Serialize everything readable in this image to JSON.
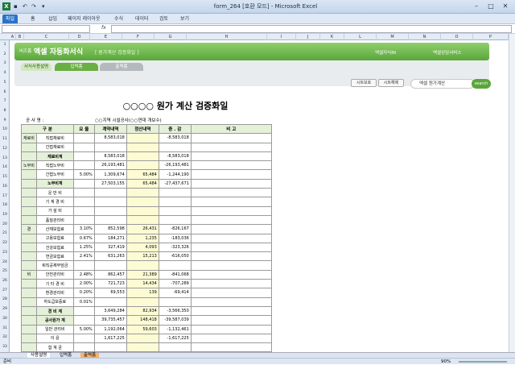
{
  "window": {
    "title": "form_264  [호환 모드] - Microsoft Excel"
  },
  "ribbon_tabs": [
    "파일",
    "홈",
    "삽입",
    "페이지 레이아웃",
    "수식",
    "데이터",
    "검토",
    "보기"
  ],
  "columns": [
    "A",
    "B",
    "C",
    "D",
    "E",
    "F",
    "G",
    "H",
    "I",
    "J",
    "K",
    "L",
    "M",
    "N",
    "O",
    "P"
  ],
  "rows": [
    "1",
    "2",
    "3",
    "4",
    "5",
    "6",
    "7",
    "8",
    "9",
    "10",
    "11",
    "12",
    "13",
    "14",
    "15",
    "16",
    "17",
    "18",
    "19",
    "20",
    "21",
    "22",
    "23",
    "24",
    "25",
    "26",
    "27",
    "28",
    "29",
    "30",
    "31",
    "32",
    "33"
  ],
  "banner": {
    "logo": "비즈폼",
    "title": "엑셀 자동화서식",
    "subtitle": "[ 원가계산 검증화일 ]",
    "link1": "엑셀자식IN",
    "link2": "엑셀상담서비스"
  },
  "nav_tabs": {
    "howto": "서식사용설명",
    "input": "입력폼",
    "output": "출력폼"
  },
  "buttons": {
    "show_sheet": "시트보호",
    "unprotect": "시트해제"
  },
  "search": {
    "value": "엑셀 원가계산",
    "button": "search"
  },
  "document": {
    "title": "○○○○ 원가 계산 검증화일",
    "project_label": "공 사 명 :",
    "project_value": "○○지역 시설공사(○○연대 개보수)"
  },
  "table": {
    "headers": [
      "구   분",
      "",
      "요 율",
      "계약내역",
      "정산내역",
      "증 . 감",
      "비  고"
    ],
    "rows": [
      {
        "g": "재료비",
        "item": "직접재료비",
        "rate": "",
        "contract": "8,583,018",
        "settle": "",
        "diff": "-8,583,018"
      },
      {
        "g": "",
        "item": "간접재료비",
        "rate": "",
        "contract": "",
        "settle": "",
        "diff": ""
      },
      {
        "g": "",
        "item": "재료비계",
        "rate": "",
        "contract": "8,583,018",
        "settle": "",
        "diff": "-8,583,018"
      },
      {
        "g": "노무비",
        "item": "직접노무비",
        "rate": "",
        "contract": "26,193,481",
        "settle": "",
        "diff": "-26,193,481"
      },
      {
        "g": "",
        "item": "간접노무비",
        "rate": "5.00%",
        "contract": "1,309,674",
        "settle": "65,484",
        "diff": "-1,244,190"
      },
      {
        "g": "",
        "item": "노무비계",
        "rate": "",
        "contract": "27,503,155",
        "settle": "65,484",
        "diff": "-27,437,671"
      },
      {
        "g": "",
        "item": "운 반 비",
        "rate": "",
        "contract": "",
        "settle": "",
        "diff": ""
      },
      {
        "g": "",
        "item": "기 계 경 비",
        "rate": "",
        "contract": "",
        "settle": "",
        "diff": ""
      },
      {
        "g": "",
        "item": "가 설 비",
        "rate": "",
        "contract": "",
        "settle": "",
        "diff": ""
      },
      {
        "g": "",
        "item": "품질관리비",
        "rate": "",
        "contract": "",
        "settle": "",
        "diff": ""
      },
      {
        "g": "경",
        "item": "산재보험료",
        "rate": "3.10%",
        "contract": "852,598",
        "settle": "26,431",
        "diff": "-826,167"
      },
      {
        "g": "",
        "item": "고용보험료",
        "rate": "0.67%",
        "contract": "184,271",
        "settle": "1,235",
        "diff": "-183,036"
      },
      {
        "g": "",
        "item": "건강보험료",
        "rate": "1.25%",
        "contract": "327,419",
        "settle": "4,093",
        "diff": "-323,326"
      },
      {
        "g": "",
        "item": "연금보험료",
        "rate": "2.41%",
        "contract": "631,263",
        "settle": "15,213",
        "diff": "-616,050"
      },
      {
        "g": "",
        "item": "퇴직공제부담금",
        "rate": "",
        "contract": "",
        "settle": "",
        "diff": ""
      },
      {
        "g": "비",
        "item": "안전관리비",
        "rate": "2.48%",
        "contract": "862,457",
        "settle": "21,389",
        "diff": "-841,068"
      },
      {
        "g": "",
        "item": "기 타 경 비",
        "rate": "2.00%",
        "contract": "721,723",
        "settle": "14,434",
        "diff": "-707,289"
      },
      {
        "g": "",
        "item": "환경관리비",
        "rate": "0.20%",
        "contract": "69,553",
        "settle": "139",
        "diff": "-69,414"
      },
      {
        "g": "",
        "item": "하도급보증료",
        "rate": "0.01%",
        "contract": "",
        "settle": "",
        "diff": ""
      },
      {
        "g": "",
        "item": "경 비 계",
        "rate": "",
        "contract": "3,649,284",
        "settle": "82,934",
        "diff": "-3,566,350"
      },
      {
        "g": "",
        "item": "공사원가 계",
        "rate": "",
        "contract": "39,735,457",
        "settle": "148,418",
        "diff": "-39,587,039"
      },
      {
        "g": "",
        "item": "일반 관리비",
        "rate": "5.00%",
        "contract": "1,192,064",
        "settle": "59,603",
        "diff": "-1,132,461"
      },
      {
        "g": "",
        "item": "이      윤",
        "rate": "",
        "contract": "1,617,225",
        "settle": "",
        "diff": "-1,617,225"
      },
      {
        "g": "",
        "item": "합 계 금",
        "rate": "",
        "contract": "",
        "settle": "",
        "diff": ""
      }
    ]
  },
  "sheet_tabs": [
    "사용설명",
    "입력폼",
    "출력폼"
  ],
  "status": {
    "ready": "준비",
    "zoom": "90%"
  }
}
